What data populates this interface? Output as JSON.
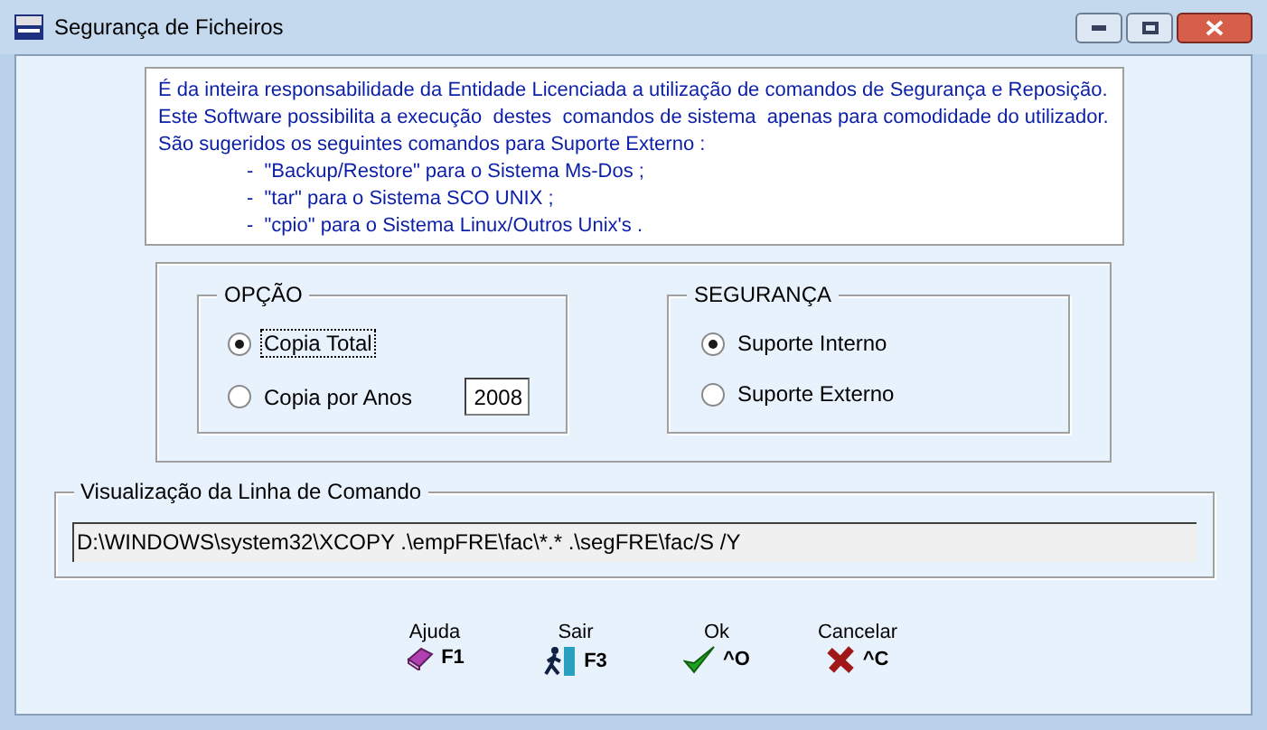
{
  "window": {
    "title": "Segurança de Ficheiros"
  },
  "notice": {
    "lines": [
      "É da inteira responsabilidade da Entidade Licenciada a utilização de comandos de Segurança e Reposição.",
      "Este Software possibilita a execução  destes  comandos de sistema  apenas para comodidade do utilizador.",
      "São sugeridos os seguintes comandos para Suporte Externo :"
    ],
    "bullets": [
      "-  \"Backup/Restore\" para o Sistema Ms-Dos ;",
      "-  \"tar\" para o Sistema SCO UNIX ;",
      "-  \"cpio\" para o Sistema Linux/Outros Unix's ."
    ]
  },
  "option_group": {
    "title": "OPÇÃO",
    "options": [
      {
        "label": "Copia Total",
        "selected": true,
        "focused": true
      },
      {
        "label": "Copia por Anos",
        "selected": false,
        "focused": false,
        "year": "2008"
      }
    ]
  },
  "security_group": {
    "title": "SEGURANÇA",
    "options": [
      {
        "label": "Suporte Interno",
        "selected": true
      },
      {
        "label": "Suporte Externo",
        "selected": false
      }
    ]
  },
  "command_group": {
    "title": "Visualização da Linha de Comando",
    "value": "D:\\WINDOWS\\system32\\XCOPY .\\empFRE\\fac\\*.* .\\segFRE\\fac/S /Y"
  },
  "buttons": [
    {
      "kind": "help",
      "label": "Ajuda",
      "key": "F1"
    },
    {
      "kind": "exit",
      "label": "Sair",
      "key": "F3"
    },
    {
      "kind": "ok",
      "label": "Ok",
      "key": "^O"
    },
    {
      "kind": "cancel",
      "label": "Cancelar",
      "key": "^C"
    }
  ]
}
